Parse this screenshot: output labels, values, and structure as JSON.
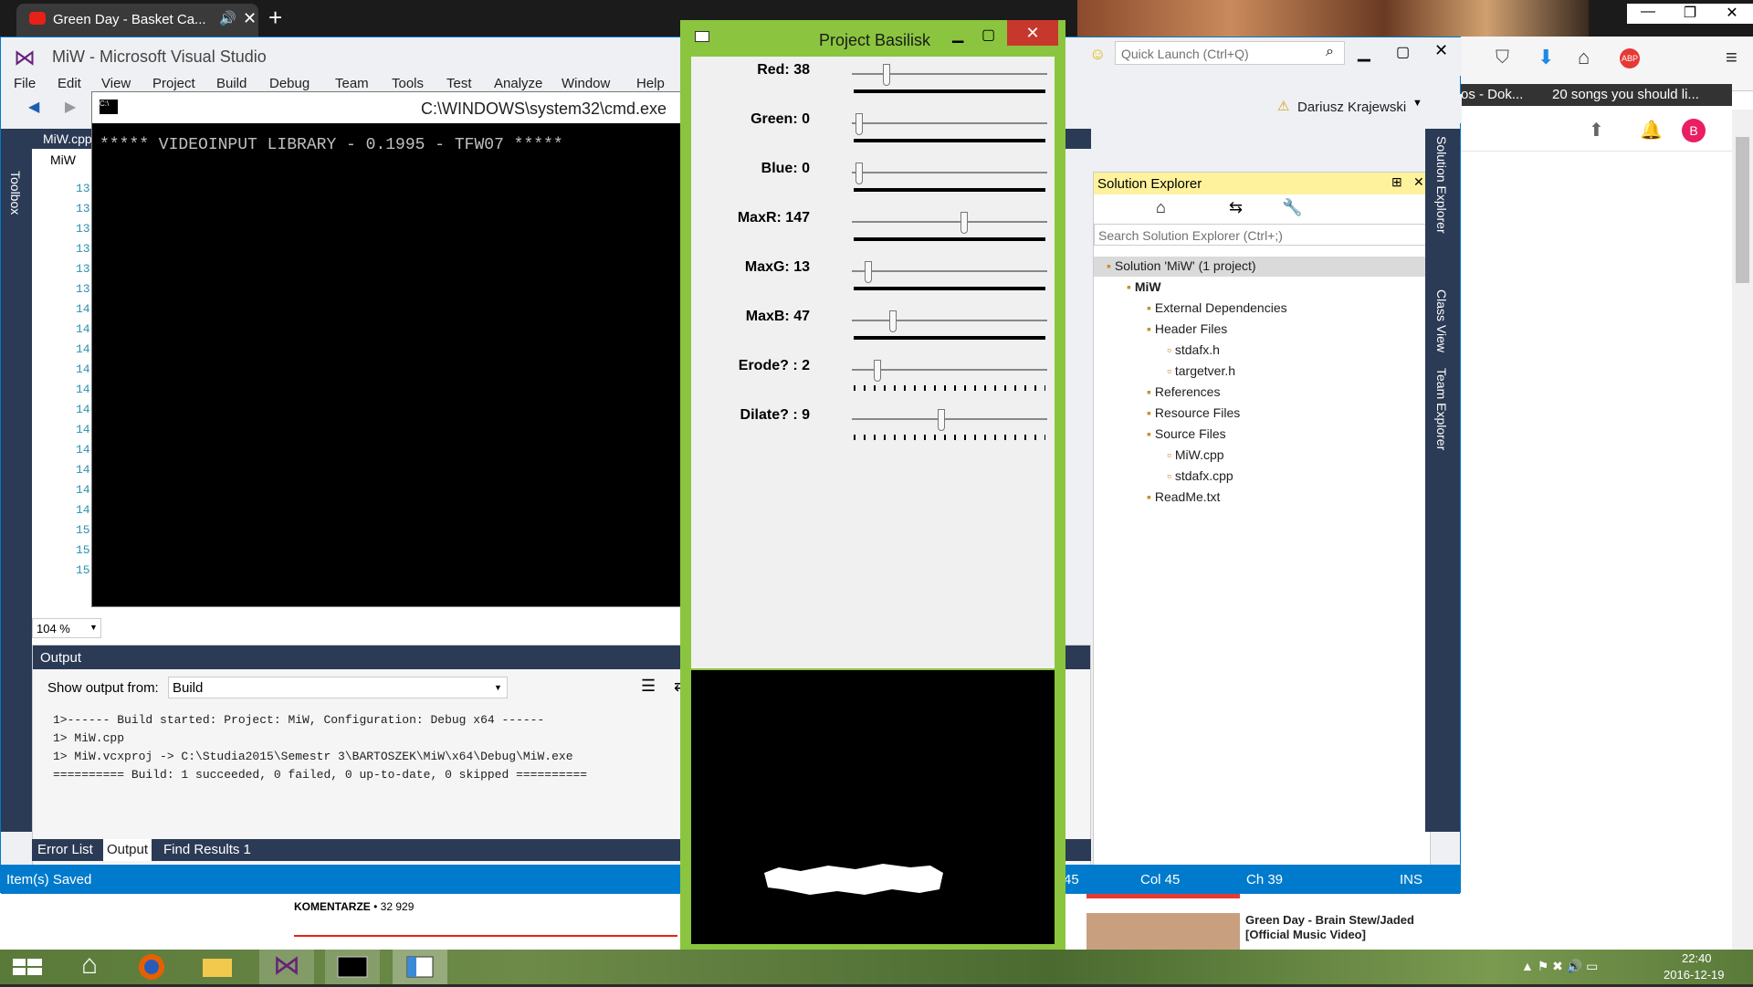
{
  "browser": {
    "tab_title": "Green Day - Basket Ca...",
    "yt_items": [
      "os - Dok...",
      "20 songs you should li..."
    ],
    "avatar_letter": "B",
    "comments_label": "KOMENTARZE",
    "comments_count": "• 32 929",
    "related_title": "Green Day - Brain Stew/Jaded [Official Music Video]"
  },
  "vs": {
    "title": "MiW - Microsoft Visual Studio",
    "menu": [
      "File",
      "Edit",
      "View",
      "Project",
      "Build",
      "Debug",
      "Team",
      "Tools",
      "Test",
      "Analyze",
      "Window",
      "Help"
    ],
    "quick_launch": "Quick Launch (Ctrl+Q)",
    "user": "Dariusz Krajewski",
    "toolbox_label": "Toolbox",
    "editor_tab": "MiW.cpp",
    "editor_scope": "MiW",
    "line_numbers": [
      "13",
      "13",
      "13",
      "13",
      "13",
      "13",
      "14",
      "14",
      "14",
      "14",
      "14",
      "14",
      "14",
      "14",
      "14",
      "14",
      "14",
      "15",
      "15",
      "15"
    ],
    "zoom": "104 %",
    "output": {
      "header": "Output",
      "show_from_label": "Show output from:",
      "show_from_value": "Build",
      "lines": [
        "1>------ Build started: Project: MiW, Configuration: Debug x64 ------",
        "1>  MiW.cpp",
        "1>  MiW.vcxproj -> C:\\Studia2015\\Semestr 3\\BARTOSZEK\\MiW\\x64\\Debug\\MiW.exe",
        "========== Build: 1 succeeded, 0 failed, 0 up-to-date, 0 skipped =========="
      ]
    },
    "bottom_tabs": [
      "Error List",
      "Output",
      "Find Results 1"
    ],
    "status": {
      "message": "Item(s) Saved",
      "ln": "45",
      "col": "Col 45",
      "ch": "Ch 39",
      "mode": "INS"
    },
    "solution_explorer": {
      "title": "Solution Explorer",
      "search_placeholder": "Search Solution Explorer (Ctrl+;)",
      "side_tabs": [
        "Solution Explorer",
        "Class View",
        "Team Explorer"
      ],
      "items": [
        {
          "label": "Solution 'MiW' (1 project)",
          "level": 0
        },
        {
          "label": "MiW",
          "level": 1
        },
        {
          "label": "External Dependencies",
          "level": 2
        },
        {
          "label": "Header Files",
          "level": 2
        },
        {
          "label": "stdafx.h",
          "level": 3
        },
        {
          "label": "targetver.h",
          "level": 3
        },
        {
          "label": "References",
          "level": 2
        },
        {
          "label": "Resource Files",
          "level": 2
        },
        {
          "label": "Source Files",
          "level": 2
        },
        {
          "label": "MiW.cpp",
          "level": 3
        },
        {
          "label": "stdafx.cpp",
          "level": 3
        },
        {
          "label": "ReadMe.txt",
          "level": 2
        }
      ]
    }
  },
  "cmd": {
    "title": "C:\\WINDOWS\\system32\\cmd.exe",
    "text": "***** VIDEOINPUT LIBRARY - 0.1995 - TFW07 *****"
  },
  "basilisk": {
    "title": "Project Basilisk",
    "trackbars": [
      {
        "label": "Red: 38",
        "value": 38,
        "max": 255
      },
      {
        "label": "Green: 0",
        "value": 0,
        "max": 255
      },
      {
        "label": "Blue: 0",
        "value": 0,
        "max": 255
      },
      {
        "label": "MaxR: 147",
        "value": 147,
        "max": 255
      },
      {
        "label": "MaxG: 13",
        "value": 13,
        "max": 255
      },
      {
        "label": "MaxB: 47",
        "value": 47,
        "max": 255
      },
      {
        "label": "Erode? : 2",
        "value": 2,
        "max": 20
      },
      {
        "label": "Dilate? : 9",
        "value": 9,
        "max": 20
      }
    ]
  },
  "taskbar": {
    "time": "22:40",
    "date": "2016-12-19"
  }
}
